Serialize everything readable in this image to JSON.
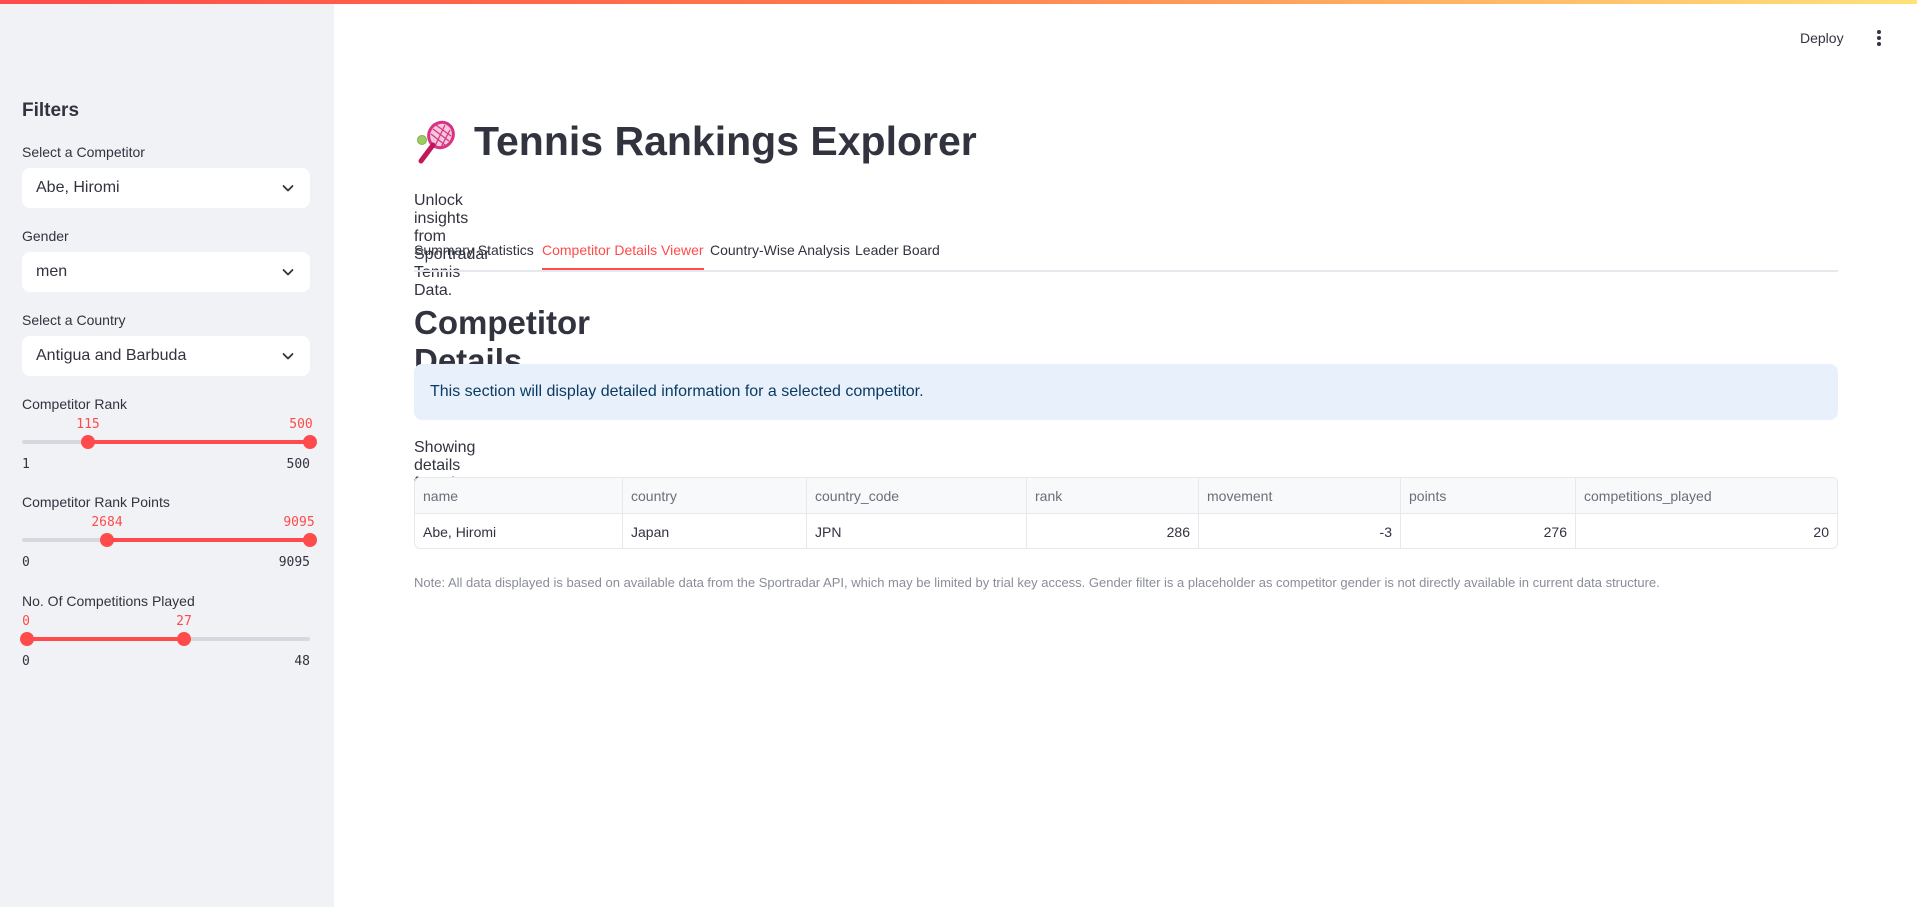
{
  "sidebar": {
    "title": "Filters",
    "competitor": {
      "label": "Select a Competitor",
      "value": "Abe, Hiromi"
    },
    "gender": {
      "label": "Gender",
      "value": "men"
    },
    "country": {
      "label": "Select a Country",
      "value": "Antigua and Barbuda"
    },
    "rank": {
      "label": "Competitor Rank",
      "low": "115",
      "high": "500",
      "min": "1",
      "max": "500"
    },
    "points": {
      "label": "Competitor Rank Points",
      "low": "2684",
      "high": "9095",
      "min": "0",
      "max": "9095"
    },
    "competitions": {
      "label": "No. Of Competitions Played",
      "low": "0",
      "high": "27",
      "min": "0",
      "max": "48"
    }
  },
  "header": {
    "deploy_label": "Deploy",
    "menu_icon": "kebab-menu-icon"
  },
  "main": {
    "title": "Tennis Rankings Explorer",
    "title_icon": "tennis-racket-icon",
    "subtitle": "Unlock insights from Sportradar Tennis Data.",
    "tabs": [
      {
        "label": "Summary Statistics"
      },
      {
        "label": "Competitor Details Viewer"
      },
      {
        "label": "Country-Wise Analysis"
      },
      {
        "label": "Leader Board"
      }
    ],
    "active_tab": "Competitor Details Viewer",
    "section_title": "Competitor Details Viewer",
    "info_text": "This section will display detailed information for a selected competitor.",
    "showing_text": "Showing details for: Abe, Hiromi",
    "table": {
      "columns": [
        "name",
        "country",
        "country_code",
        "rank",
        "movement",
        "points",
        "competitions_played"
      ],
      "rows": [
        [
          "Abe, Hiromi",
          "Japan",
          "JPN",
          "286",
          "-3",
          "276",
          "20"
        ]
      ]
    },
    "note": "Note: All data displayed is based on available data from the Sportradar API, which may be limited by trial key access. Gender filter is a placeholder as competitor gender is not directly available in current data structure."
  },
  "colors": {
    "accent": "#ff4b4b",
    "sidebar_bg": "#f0f2f6",
    "info_bg": "#e8f1fb",
    "text": "#31333f"
  }
}
